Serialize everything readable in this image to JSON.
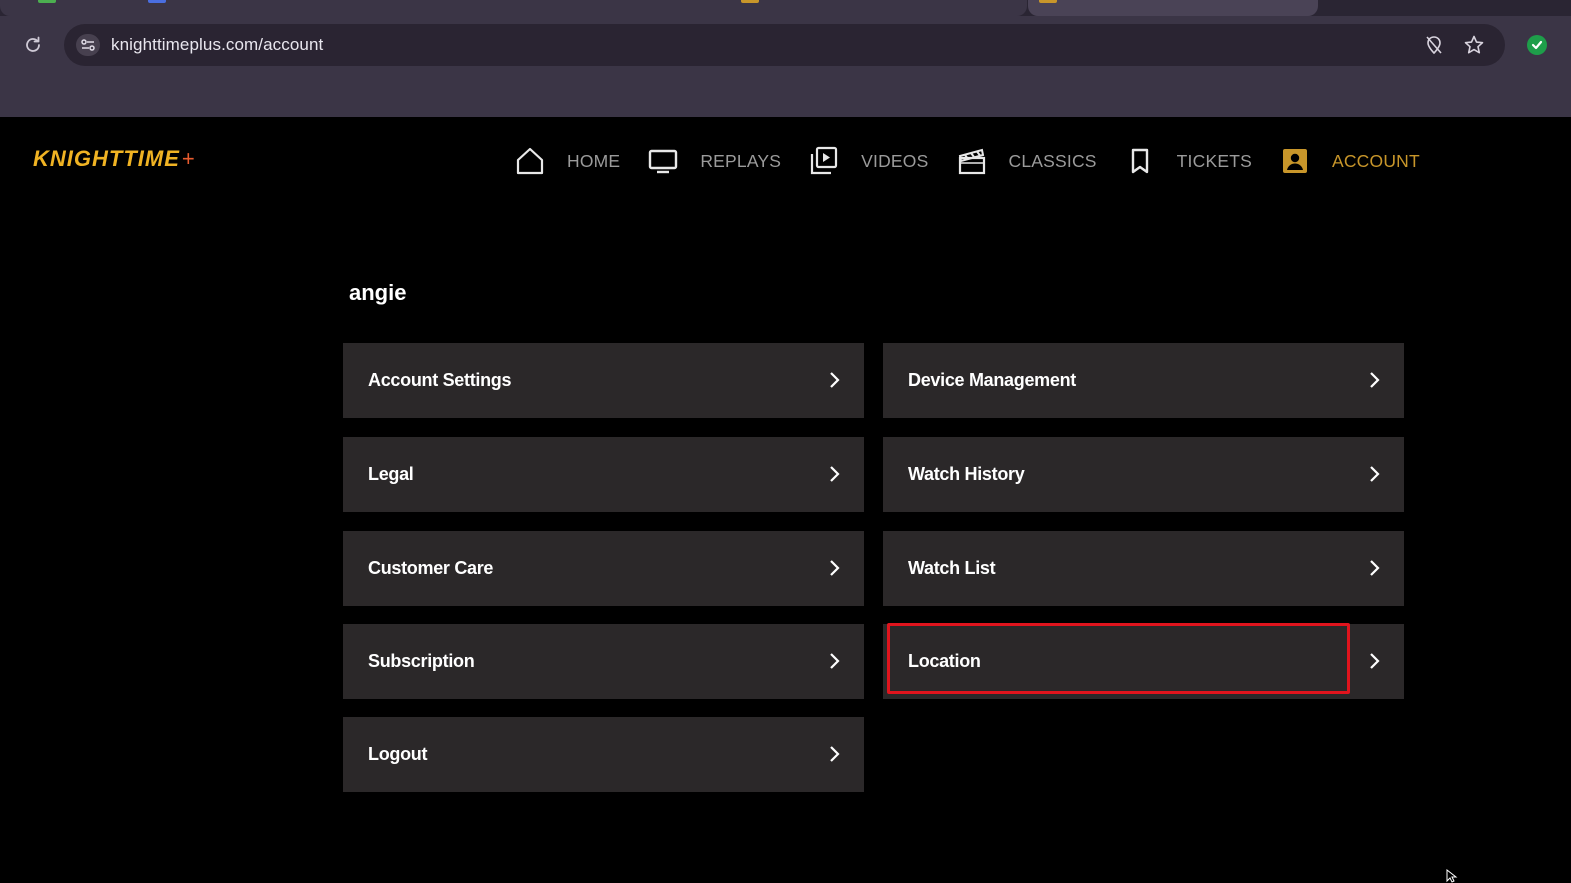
{
  "browser": {
    "url": "knighttimeplus.com/account",
    "icons": [
      "reload-icon",
      "site-info-icon",
      "tracking-protection-icon",
      "bookmark-star-icon",
      "extension-icon"
    ]
  },
  "site": {
    "logo": "KNIGHTTIME",
    "logo_plus": "+",
    "colors": {
      "accent": "#f0b323",
      "active_nav": "#c8962a",
      "card_bg": "#2b2829",
      "highlight": "#e0141d"
    },
    "nav": [
      {
        "label": "HOME",
        "icon": "home-icon"
      },
      {
        "label": "REPLAYS",
        "icon": "monitor-icon"
      },
      {
        "label": "VIDEOS",
        "icon": "video-library-icon"
      },
      {
        "label": "CLASSICS",
        "icon": "clapperboard-icon"
      },
      {
        "label": "TICKETS",
        "icon": "bookmark-icon"
      },
      {
        "label": "ACCOUNT",
        "icon": "account-box-icon",
        "active": true
      }
    ]
  },
  "account": {
    "username": "angie",
    "items": [
      "Account Settings",
      "Device Management",
      "Legal",
      "Watch History",
      "Customer Care",
      "Watch List",
      "Subscription",
      "Location",
      "Logout"
    ],
    "highlighted_item": "Location"
  }
}
